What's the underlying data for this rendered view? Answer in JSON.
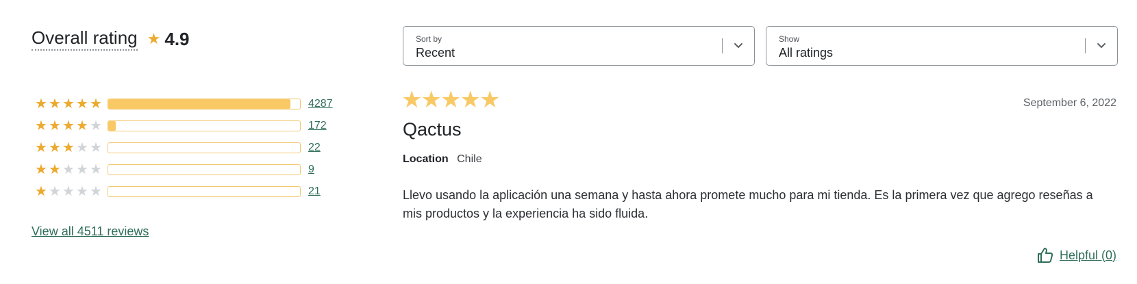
{
  "overall": {
    "label": "Overall rating",
    "star_icon": "★",
    "value": "4.9"
  },
  "distribution": [
    {
      "stars": 5,
      "count": "4287",
      "fill": 0.95
    },
    {
      "stars": 4,
      "count": "172",
      "fill": 0.04
    },
    {
      "stars": 3,
      "count": "22",
      "fill": 0.0
    },
    {
      "stars": 2,
      "count": "9",
      "fill": 0.0
    },
    {
      "stars": 1,
      "count": "21",
      "fill": 0.0
    }
  ],
  "view_all": "View all 4511 reviews",
  "sort": {
    "label": "Sort by",
    "value": "Recent"
  },
  "show": {
    "label": "Show",
    "value": "All ratings"
  },
  "review": {
    "rating": 5,
    "date": "September 6, 2022",
    "reviewer": "Qactus",
    "location_label": "Location",
    "location": "Chile",
    "body": "Llevo usando la aplicación una semana y hasta ahora promete mucho para mi tienda. Es la primera vez que agrego reseñas a mis productos y la experiencia ha sido fluida.",
    "helpful": "Helpful (0)"
  },
  "colors": {
    "star": "#ecaa2f",
    "star_empty": "#d2d5d8",
    "bar_fill": "#f9c966",
    "link": "#2f6e5a"
  }
}
